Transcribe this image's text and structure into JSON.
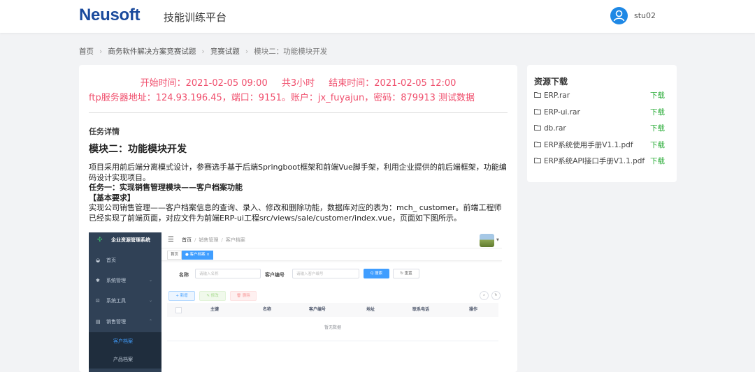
{
  "header": {
    "logo": "Neusoft",
    "title": "技能训练平台",
    "user": "stu02",
    "icons": {
      "avatar": "user-avatar-icon"
    },
    "colors": {
      "logo": "#1a4a9c",
      "avatar": "#1e88e5"
    }
  },
  "breadcrumb": [
    "首页",
    "商务软件解决方案竞赛试题",
    "竞赛试题",
    "模块二：功能模块开发"
  ],
  "exam": {
    "start": "开始时间：2021-02-05 09:00",
    "duration": "共3小时",
    "end": "结束时间：2021-02-05 12:00",
    "ftp": "ftp服务器地址：124.93.196.45，端口：9151。账户：jx_fuyajun，密码：879913 测试数据",
    "color": "#f0506e"
  },
  "task": {
    "section_label": "任务详情",
    "module_title": "模块二：功能模块开发",
    "intro": "项目采用前后端分离模式设计，参赛选手基于后端Springboot框架和前端Vue脚手架，利用企业提供的前后端框架，功能编码设计实现项目。",
    "task1_title": "任务一：实现销售管理模块——客户档案功能",
    "basic_req": "【基本要求】",
    "req_text": "实现公司销售管理——客户档案信息的查询、录入、修改和删除功能，数据库对应的表为：mch_ customer。前端工程师已经实现了前端页面，对应文件为前端ERP-ui工程src/views/sale/customer/index.vue，页面如下图所示。"
  },
  "erp": {
    "system_title": "企业资源管理系统",
    "menu": [
      {
        "label": "首页",
        "icon": "dashboard-icon"
      },
      {
        "label": "系统管理",
        "icon": "gear-icon"
      },
      {
        "label": "系统工具",
        "icon": "tool-icon"
      },
      {
        "label": "销售管理",
        "icon": "document-icon"
      }
    ],
    "submenu": [
      "客户档案",
      "产品档案"
    ],
    "nav_breadcrumb": [
      "首页",
      "销售管理",
      "客户档案"
    ],
    "tags": [
      "首页",
      "● 客户档案 ×"
    ],
    "search": {
      "name_label": "名称",
      "name_placeholder": "请输入名称",
      "code_label": "客户编号",
      "code_placeholder": "请输入客户编号",
      "search_btn": "Q 搜索",
      "reset_btn": "↻ 重置"
    },
    "actions": {
      "add": "+ 新增",
      "edit": "✎ 修改",
      "delete": "🗑 删除"
    },
    "table_headers": [
      "主键",
      "名称",
      "客户编号",
      "地址",
      "联系电话",
      "操作"
    ],
    "empty_text": "暂无数据"
  },
  "resources": {
    "title": "资源下载",
    "download_label": "下载",
    "download_color": "#2eae3c",
    "files": [
      "ERP.rar",
      "ERP-ui.rar",
      "db.rar",
      "ERP系统使用手册V1.1.pdf",
      "ERP系统API接口手册V1.1.pdf"
    ]
  }
}
